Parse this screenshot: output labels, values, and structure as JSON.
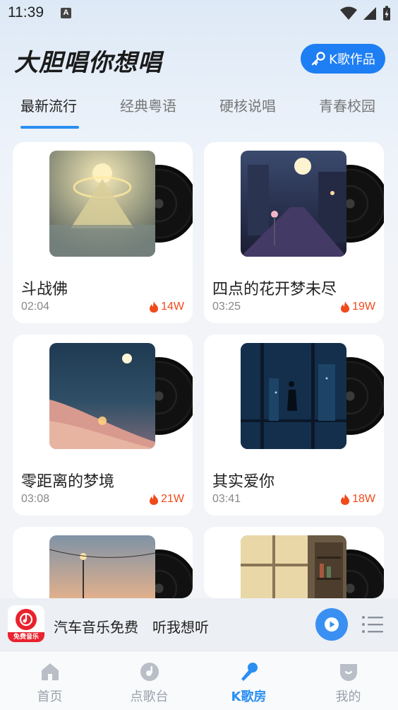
{
  "status_bar": {
    "time": "11:39",
    "indicator": "A"
  },
  "header": {
    "title": "大胆唱你想唱",
    "works_button_label": "K歌作品",
    "works_button_icon": "key-icon"
  },
  "tabs": [
    {
      "label": "最新流行",
      "active": true
    },
    {
      "label": "经典粤语",
      "active": false
    },
    {
      "label": "硬核说唱",
      "active": false
    },
    {
      "label": "青春校园",
      "active": false
    }
  ],
  "songs": [
    {
      "title": "斗战佛",
      "duration": "02:04",
      "hot": "14W",
      "cover": "glowing-mountain-cover"
    },
    {
      "title": "四点的花开梦未尽",
      "duration": "03:25",
      "hot": "19W",
      "cover": "night-street-flower-cover"
    },
    {
      "title": "零距离的梦境",
      "duration": "03:08",
      "hot": "21W",
      "cover": "petal-beach-moon-cover"
    },
    {
      "title": "其实爱你",
      "duration": "03:41",
      "hot": "18W",
      "cover": "city-window-night-cover"
    },
    {
      "title": "",
      "duration": "",
      "hot": "",
      "cover": "sunset-streetlight-cover"
    },
    {
      "title": "",
      "duration": "",
      "hot": "",
      "cover": "sunlit-room-window-cover"
    }
  ],
  "player": {
    "logo_caption": "免费音乐",
    "text": "汽车音乐免费　听我想听",
    "play_icon": "play-icon",
    "playlist_icon": "playlist-icon"
  },
  "bottom_nav": [
    {
      "label": "首页",
      "icon": "home-icon",
      "active": false
    },
    {
      "label": "点歌台",
      "icon": "music-disc-icon",
      "active": false
    },
    {
      "label": "K歌房",
      "icon": "microphone-icon",
      "active": true
    },
    {
      "label": "我的",
      "icon": "profile-icon",
      "active": false
    }
  ],
  "colors": {
    "accent": "#2a8ff0",
    "hot": "#f04a1c",
    "button": "#1e7ef3"
  }
}
